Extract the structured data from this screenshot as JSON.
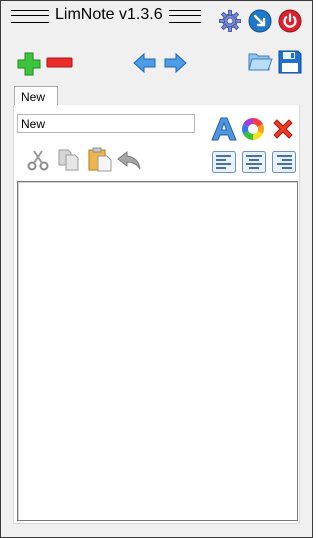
{
  "app": {
    "title": "LimNote v1.3.6"
  },
  "titlebar_icons": [
    {
      "name": "settings-gear-icon",
      "color": "#6a5acd"
    },
    {
      "name": "minimize-to-tray-icon",
      "color": "#1f78c8"
    },
    {
      "name": "power-exit-icon",
      "color": "#d9232e"
    }
  ],
  "toolbar": {
    "add": {
      "icon": "plus-icon",
      "color": "#2eb82e"
    },
    "remove": {
      "icon": "minus-icon",
      "color": "#e02020"
    },
    "prev": {
      "icon": "arrow-left-icon",
      "color": "#3c8fe0"
    },
    "next": {
      "icon": "arrow-right-icon",
      "color": "#3c8fe0"
    },
    "open": {
      "icon": "folder-open-icon",
      "color": "#6fb3e8"
    },
    "save": {
      "icon": "floppy-disk-icon",
      "color": "#1f6fd0"
    }
  },
  "tabs": [
    {
      "label": "New",
      "active": true
    }
  ],
  "note": {
    "name_value": "New",
    "body_text": ""
  },
  "format_tools": {
    "font": {
      "icon": "font-letter-a-icon",
      "color": "#3f88d8"
    },
    "color": {
      "icon": "color-wheel-icon"
    },
    "delete": {
      "icon": "red-x-delete-icon",
      "color": "#e0301e"
    },
    "cut": {
      "icon": "scissors-cut-icon"
    },
    "copy": {
      "icon": "copy-icon"
    },
    "paste": {
      "icon": "paste-icon"
    },
    "undo": {
      "icon": "undo-icon"
    },
    "align_left": {
      "icon": "align-left-icon"
    },
    "align_center": {
      "icon": "align-center-icon"
    },
    "align_right": {
      "icon": "align-right-icon"
    }
  }
}
